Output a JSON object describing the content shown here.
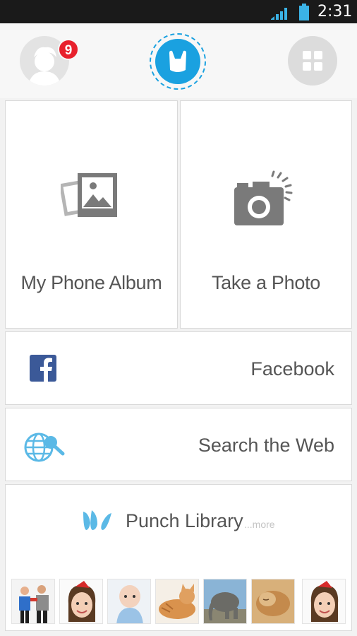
{
  "status_bar": {
    "time": "2:31",
    "icons": [
      "signal-icon",
      "battery-icon"
    ]
  },
  "header": {
    "notification_count": "9",
    "icons": [
      "avatar-icon",
      "punch-logo-icon",
      "grid-apps-icon"
    ]
  },
  "tiles": {
    "album_label": "My Phone Album",
    "photo_label": "Take a Photo"
  },
  "rows": {
    "facebook_label": "Facebook",
    "web_label": "Search the Web"
  },
  "library": {
    "title": "Punch Library",
    "more_label": "...more",
    "thumbnails": [
      "two-people",
      "girl-red-hat",
      "baby",
      "kitten-lying",
      "elephant",
      "cat-sleeping",
      "girl-red-hat"
    ]
  },
  "colors": {
    "accent_blue": "#1aa1e0",
    "badge_red": "#e8212d",
    "facebook_blue": "#3b5998",
    "icon_gray": "#7a7a7a",
    "light_blue": "#5bb9e6"
  }
}
